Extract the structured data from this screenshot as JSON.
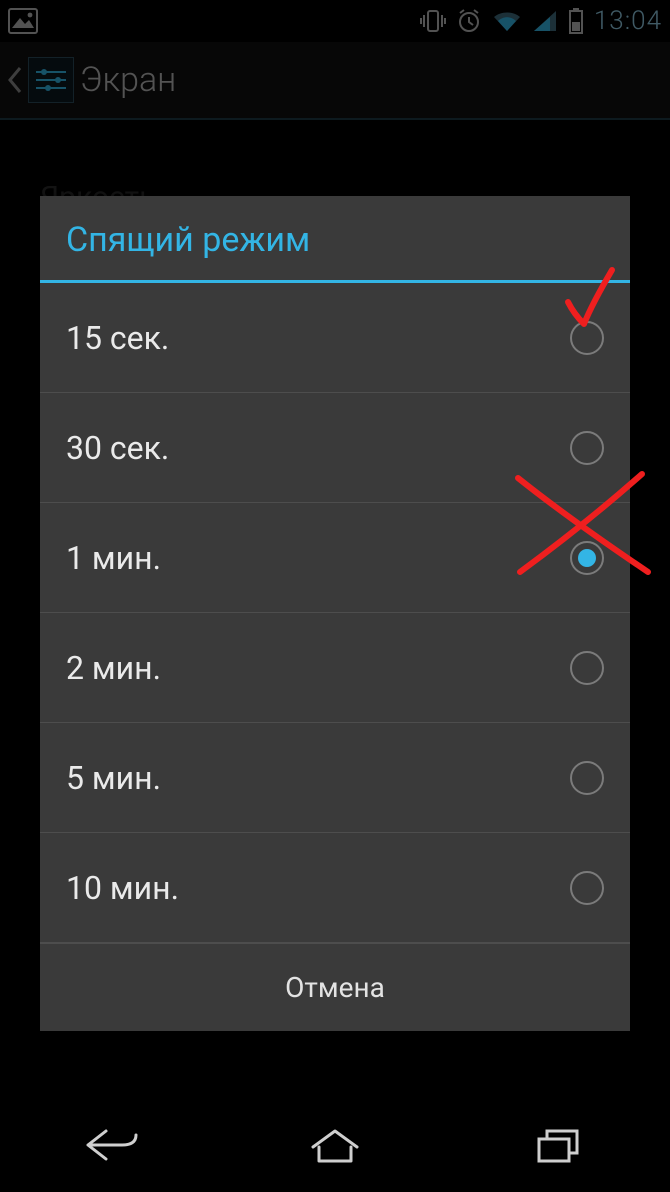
{
  "status_bar": {
    "clock": "13:04"
  },
  "action_bar": {
    "title": "Экран"
  },
  "background_settings": {
    "row0": "Яркость"
  },
  "dialog": {
    "title": "Спящий режим",
    "options": [
      {
        "label": "15 сек.",
        "selected": false
      },
      {
        "label": "30 сек.",
        "selected": false
      },
      {
        "label": "1 мин.",
        "selected": true
      },
      {
        "label": "2 мин.",
        "selected": false
      },
      {
        "label": "5 мин.",
        "selected": false
      },
      {
        "label": "10 мин.",
        "selected": false
      }
    ],
    "cancel": "Отмена"
  },
  "annotations": {
    "check_on_option_index": 0,
    "cross_on_option_index": 2,
    "color": "#ef1f1f"
  }
}
